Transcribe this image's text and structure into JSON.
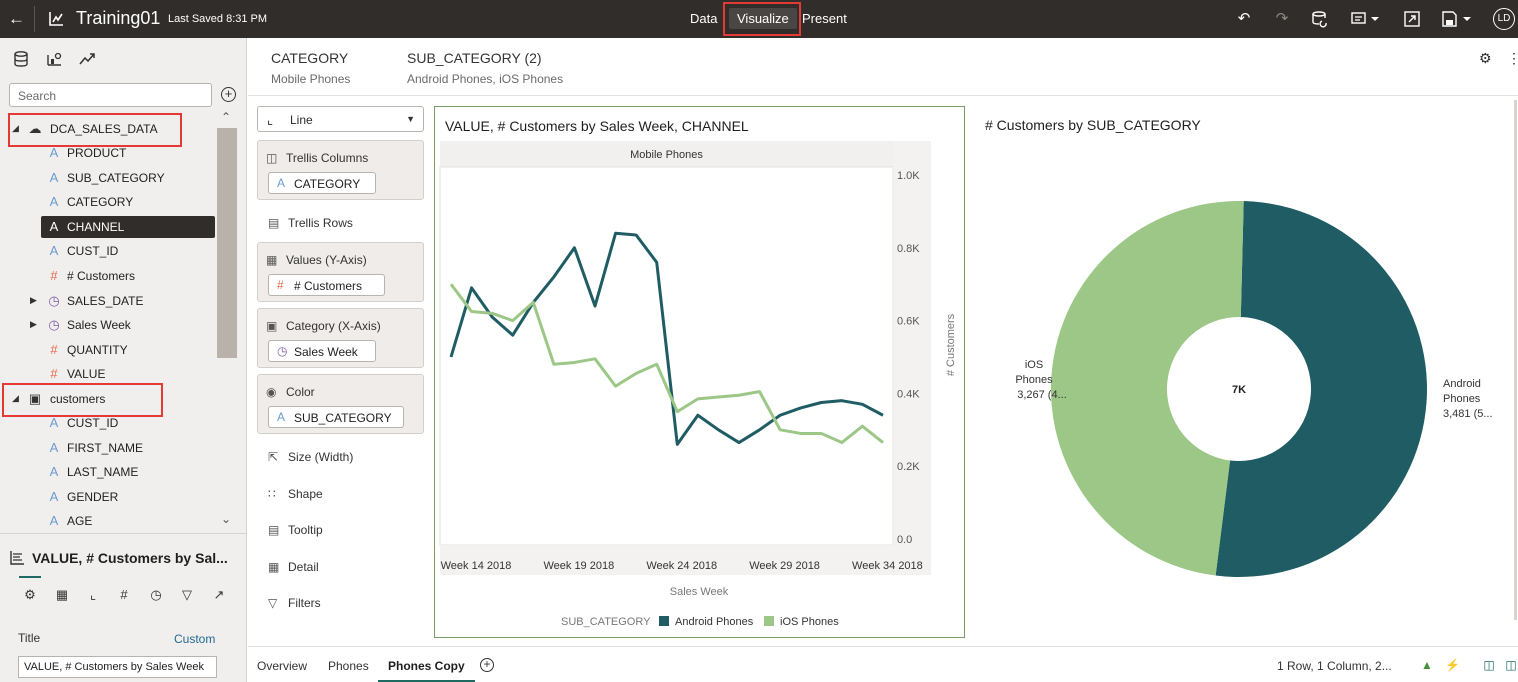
{
  "topbar": {
    "back_icon": "back-arrow-icon",
    "title": "Training01",
    "saved": "Last Saved 8:31 PM",
    "modes": [
      "Data",
      "Visualize",
      "Present"
    ],
    "active_mode": "Visualize",
    "avatar": "LD",
    "icons": [
      "undo-icon",
      "redo-icon",
      "refresh-data-icon",
      "comment-icon",
      "expand-icon",
      "save-icon"
    ]
  },
  "left": {
    "tabs": [
      "data-icon",
      "visualizations-icon",
      "analytics-icon"
    ],
    "search_placeholder": "Search",
    "tree": [
      {
        "label": "DCA_SALES_DATA",
        "type": "dataset"
      },
      {
        "label": "PRODUCT",
        "type": "attr"
      },
      {
        "label": "SUB_CATEGORY",
        "type": "attr"
      },
      {
        "label": "CATEGORY",
        "type": "attr"
      },
      {
        "label": "CHANNEL",
        "type": "attr",
        "selected": true
      },
      {
        "label": "CUST_ID",
        "type": "attr"
      },
      {
        "label": "# Customers",
        "type": "measure"
      },
      {
        "label": "SALES_DATE",
        "type": "time"
      },
      {
        "label": "Sales Week",
        "type": "time"
      },
      {
        "label": "QUANTITY",
        "type": "measure"
      },
      {
        "label": "VALUE",
        "type": "measure"
      },
      {
        "label": "customers",
        "type": "dataset"
      },
      {
        "label": "CUST_ID",
        "type": "attr"
      },
      {
        "label": "FIRST_NAME",
        "type": "attr"
      },
      {
        "label": "LAST_NAME",
        "type": "attr"
      },
      {
        "label": "GENDER",
        "type": "attr"
      },
      {
        "label": "AGE",
        "type": "attr"
      }
    ],
    "viz_title": "VALUE, # Customers by Sal...",
    "prop_label": "Title",
    "prop_link": "Custom",
    "prop_value": "VALUE, # Customers by Sales Week"
  },
  "filterbar": {
    "filters": [
      {
        "key": "CATEGORY",
        "value": "Mobile Phones"
      },
      {
        "key": "SUB_CATEGORY (2)",
        "value": "Android Phones, iOS Phones"
      }
    ]
  },
  "grammar": {
    "chart_type": "Line",
    "trellis_columns": "Trellis Columns",
    "trellis_columns_pill": "CATEGORY",
    "trellis_rows": "Trellis Rows",
    "values": "Values (Y-Axis)",
    "values_pill": "# Customers",
    "category": "Category (X-Axis)",
    "category_pill": "Sales Week",
    "color": "Color",
    "color_pill": "SUB_CATEGORY",
    "size": "Size (Width)",
    "shape": "Shape",
    "tooltip": "Tooltip",
    "detail": "Detail",
    "filters": "Filters"
  },
  "chart_data": [
    {
      "type": "line",
      "title": "VALUE, # Customers by Sales Week, CHANNEL",
      "trellis_header": "Mobile Phones",
      "xlabel": "Sales Week",
      "ylabel": "# Customers",
      "x_ticks": [
        "Week 14 2018",
        "Week 19 2018",
        "Week 24 2018",
        "Week 29 2018",
        "Week 34 2018"
      ],
      "y_ticks": [
        "1.0K",
        "0.8K",
        "0.6K",
        "0.4K",
        "0.2K",
        "0.0"
      ],
      "ylim": [
        0,
        1000
      ],
      "legend_title": "SUB_CATEGORY",
      "legend_position": "bottom",
      "grid": false,
      "x": [
        14,
        15,
        16,
        17,
        18,
        19,
        20,
        21,
        22,
        23,
        24,
        25,
        26,
        27,
        28,
        29,
        30,
        31,
        32,
        33,
        34,
        35
      ],
      "series": [
        {
          "name": "Android Phones",
          "color": "#1f5c63",
          "values": [
            500,
            690,
            610,
            560,
            650,
            720,
            800,
            640,
            840,
            835,
            760,
            260,
            340,
            300,
            265,
            300,
            340,
            360,
            375,
            380,
            370,
            340
          ]
        },
        {
          "name": "iOS Phones",
          "color": "#9cc786",
          "values": [
            700,
            625,
            620,
            600,
            650,
            480,
            485,
            495,
            420,
            455,
            480,
            350,
            385,
            390,
            395,
            405,
            300,
            290,
            290,
            265,
            310,
            265
          ]
        }
      ]
    },
    {
      "type": "pie",
      "title": "# Customers by SUB_CATEGORY",
      "center_label": "7K",
      "slices": [
        {
          "name": "Android Phones",
          "value": 3481,
          "label": "Android\nPhones\n3,481 (5...",
          "color": "#1f5c63"
        },
        {
          "name": "iOS Phones",
          "value": 3267,
          "label": "iOS\nPhones\n3,267 (4...",
          "color": "#9cc786"
        }
      ]
    }
  ],
  "bottombar": {
    "tabs": [
      "Overview",
      "Phones",
      "Phones Copy"
    ],
    "active_tab": "Phones Copy",
    "status": "1 Row, 1 Column, 2..."
  }
}
